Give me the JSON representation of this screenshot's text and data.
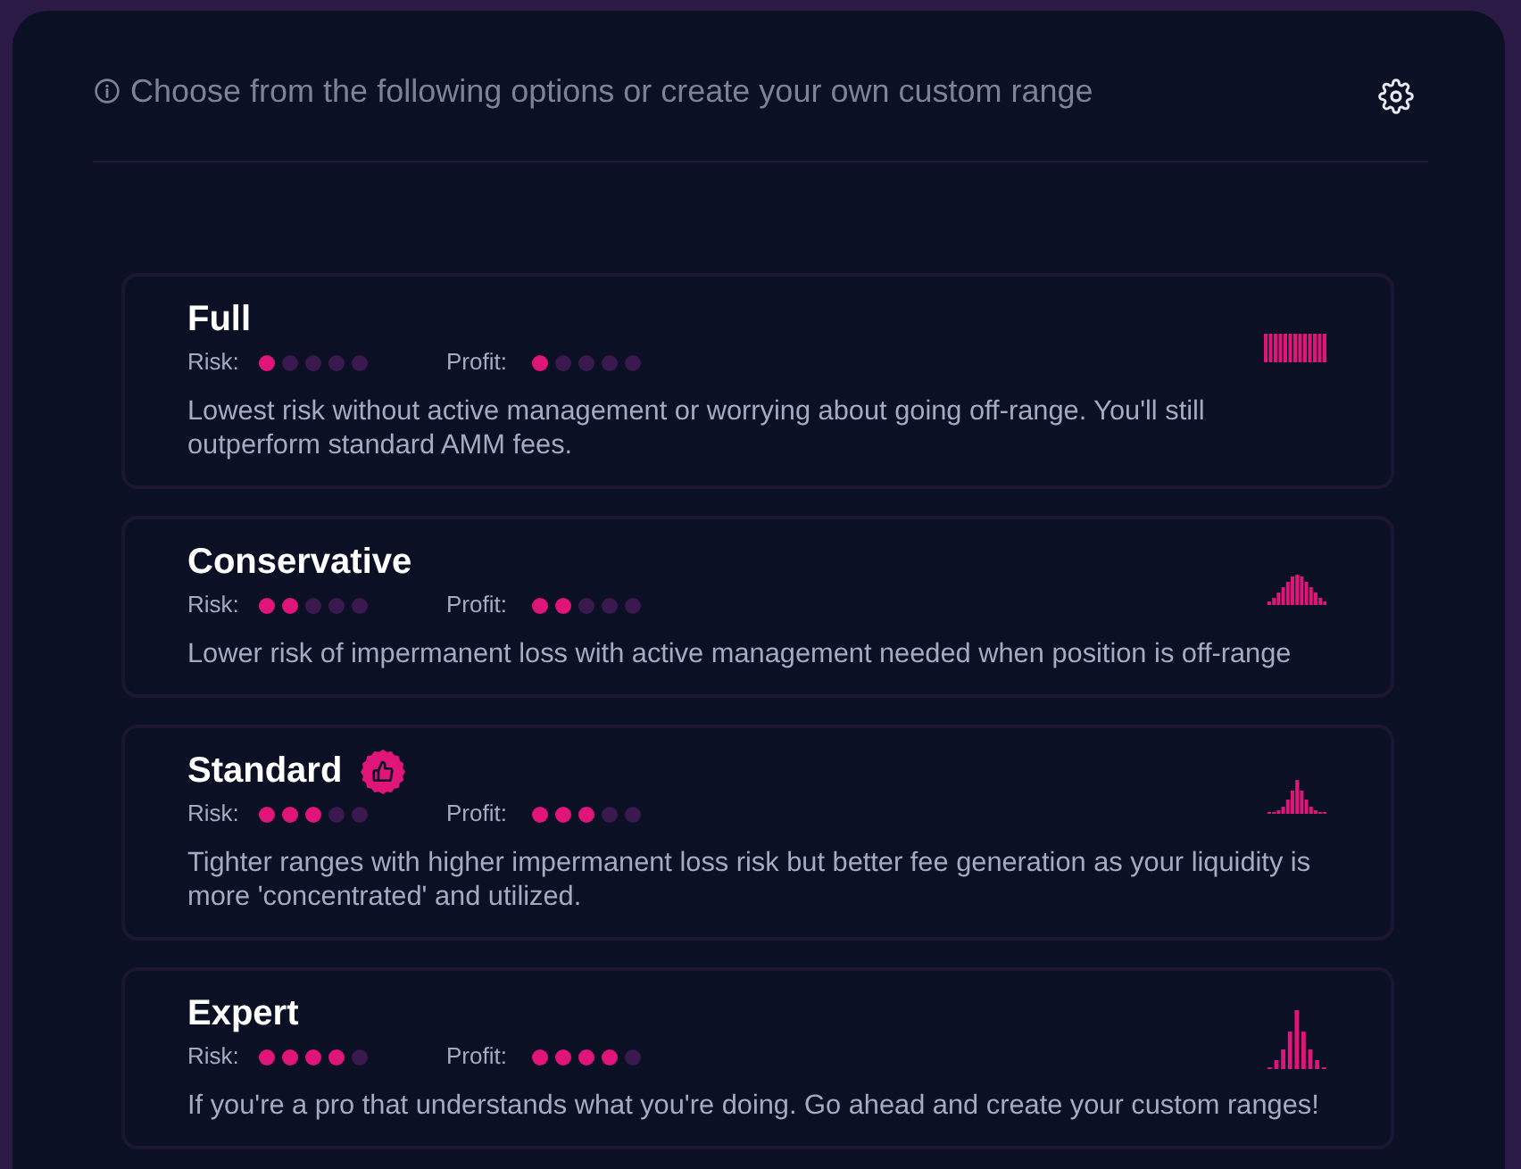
{
  "header": {
    "text": "Choose from the following options or create your own custom range"
  },
  "options": [
    {
      "title": "Full",
      "recommended": false,
      "kind": "full",
      "risk": {
        "label": "Risk:",
        "stars": 1
      },
      "profit": {
        "label": "Profit:",
        "stars": 1
      },
      "description": "Lowest risk without active management or worrying about going off-range. You'll still outperform standard AMM fees."
    },
    {
      "title": "Conservative",
      "recommended": false,
      "kind": "wide",
      "risk": {
        "label": "Risk:",
        "stars": 2
      },
      "profit": {
        "label": "Profit:",
        "stars": 2
      },
      "description": "Lower risk of impermanent loss with active management needed when position is off-range"
    },
    {
      "title": "Standard",
      "recommended": true,
      "kind": "medium",
      "risk": {
        "label": "Risk:",
        "stars": 3
      },
      "profit": {
        "label": "Profit:",
        "stars": 3
      },
      "description": "Tighter ranges with higher impermanent loss risk but better fee generation as your liquidity is more 'concentrated' and utilized."
    },
    {
      "title": "Expert",
      "recommended": false,
      "kind": "narrow",
      "risk": {
        "label": "Risk:",
        "stars": 4
      },
      "profit": {
        "label": "Profit:",
        "stars": 4
      },
      "description": "If you're a pro that understands what you're doing. Go ahead and create your custom ranges!"
    }
  ]
}
